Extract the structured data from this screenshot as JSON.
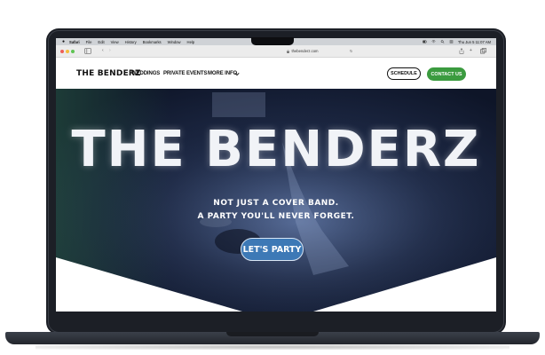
{
  "menubar": {
    "app": "Safari",
    "items": [
      "File",
      "Edit",
      "View",
      "History",
      "Bookmarks",
      "Window",
      "Help"
    ],
    "clock": "Thu Jun 5  11:07 AM"
  },
  "browser": {
    "url": "thebenderz.com"
  },
  "site": {
    "logo": "THE BENDERZ",
    "nav": [
      "WEDDINGS",
      "PRIVATE EVENTS",
      "MORE INFO"
    ],
    "schedule": "SCHEDULE",
    "contact": "CONTACT US"
  },
  "hero": {
    "title": "THE BENDERZ",
    "tagline1": "NOT JUST A COVER BAND.",
    "tagline2": "A PARTY YOU'LL NEVER FORGET.",
    "cta": "LET'S PARTY"
  },
  "colors": {
    "contact_green": "#3b9b3f",
    "cta_blue": "#3d79b6",
    "hero_navy": "#1f2b48"
  }
}
